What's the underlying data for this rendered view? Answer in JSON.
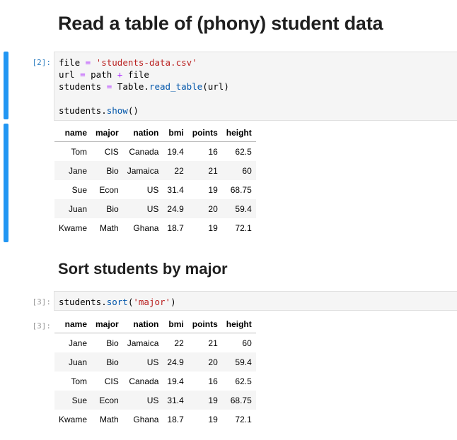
{
  "heading1": "Read a table of (phony) student data",
  "heading2": "Sort students by major",
  "cell1": {
    "prompt": "[2]:",
    "code": {
      "l1_var": "file",
      "l1_op": " = ",
      "l1_str": "'students-data.csv'",
      "l2_var": "url",
      "l2_op1": " = ",
      "l2_a": "path",
      "l2_op2": " + ",
      "l2_b": "file",
      "l3_var": "students",
      "l3_op": " = ",
      "l3_obj": "Table.",
      "l3_fn": "read_table",
      "l3_args": "(url)",
      "l5_obj": "students.",
      "l5_fn": "show",
      "l5_args": "()"
    }
  },
  "cell2": {
    "prompt_in": "[3]:",
    "prompt_out": "[3]:",
    "code": {
      "obj": "students.",
      "fn": "sort",
      "open": "(",
      "str": "'major'",
      "close": ")"
    }
  },
  "table_headers": [
    "name",
    "major",
    "nation",
    "bmi",
    "points",
    "height"
  ],
  "table1_rows": [
    [
      "Tom",
      "CIS",
      "Canada",
      "19.4",
      "16",
      "62.5"
    ],
    [
      "Jane",
      "Bio",
      "Jamaica",
      "22",
      "21",
      "60"
    ],
    [
      "Sue",
      "Econ",
      "US",
      "31.4",
      "19",
      "68.75"
    ],
    [
      "Juan",
      "Bio",
      "US",
      "24.9",
      "20",
      "59.4"
    ],
    [
      "Kwame",
      "Math",
      "Ghana",
      "18.7",
      "19",
      "72.1"
    ]
  ],
  "table2_rows": [
    [
      "Jane",
      "Bio",
      "Jamaica",
      "22",
      "21",
      "60"
    ],
    [
      "Juan",
      "Bio",
      "US",
      "24.9",
      "20",
      "59.4"
    ],
    [
      "Tom",
      "CIS",
      "Canada",
      "19.4",
      "16",
      "62.5"
    ],
    [
      "Sue",
      "Econ",
      "US",
      "31.4",
      "19",
      "68.75"
    ],
    [
      "Kwame",
      "Math",
      "Ghana",
      "18.7",
      "19",
      "72.1"
    ]
  ],
  "colors": {
    "active_bar": "#2196f3",
    "code_bg": "#f5f5f5",
    "prompt_in": "#307fc1",
    "prompt_out": "#999999"
  }
}
